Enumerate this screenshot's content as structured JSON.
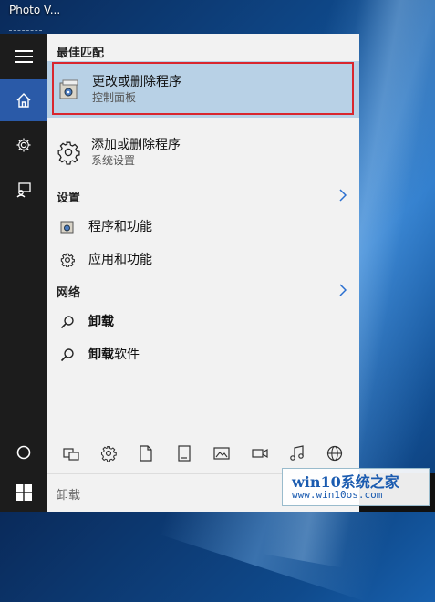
{
  "desktop": {
    "top_label": "Photo V..."
  },
  "rail": {
    "items": [
      {
        "icon": "hamburger-icon"
      },
      {
        "icon": "home-icon"
      },
      {
        "icon": "gear-icon"
      },
      {
        "icon": "feedback-icon"
      },
      {
        "icon": "power-icon"
      }
    ]
  },
  "results": {
    "best_match_header": "最佳匹配",
    "best": {
      "title": "更改或删除程序",
      "subtitle": "控制面板",
      "icon": "control-panel-icon"
    },
    "second": {
      "title": "添加或删除程序",
      "subtitle": "系统设置",
      "icon": "gear-icon"
    },
    "settings_header": "设置",
    "settings_items": [
      {
        "label": "程序和功能",
        "icon": "programs-icon"
      },
      {
        "label": "应用和功能",
        "icon": "gear-icon"
      }
    ],
    "web_header": "网络",
    "web_items": [
      {
        "label": "卸载",
        "icon": "search-icon"
      },
      {
        "label_bold": "卸载",
        "label_rest": "软件",
        "icon": "search-icon"
      }
    ]
  },
  "filter_icons": [
    "apps-icon",
    "settings-icon",
    "document-icon",
    "folder-icon",
    "photo-icon",
    "video-icon",
    "music-icon",
    "web-icon"
  ],
  "search": {
    "query": "卸载"
  },
  "watermark": {
    "line1": "win10系统之家",
    "line2": "www.win10os.com"
  },
  "colors": {
    "accent": "#2a5aa8",
    "selection": "#b8d1e6",
    "outline": "#d9262e"
  }
}
